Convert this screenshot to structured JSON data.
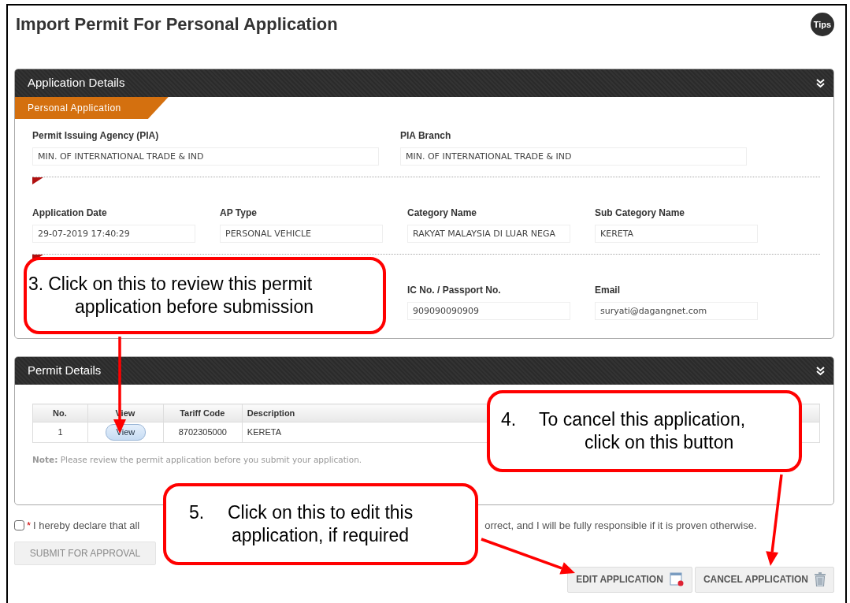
{
  "title": "Import Permit For Personal Application",
  "tips_button": "Tips",
  "application_panel": {
    "title": "Application Details",
    "section_tab": "Personal Application",
    "field_rows": [
      [
        {
          "label": "Permit Issuing Agency (PIA)",
          "value": "MIN. OF INTERNATIONAL TRADE & IND"
        },
        {
          "label": "PIA Branch",
          "value": "MIN. OF INTERNATIONAL TRADE & IND"
        }
      ],
      [
        {
          "label": "Application Date",
          "value": "29-07-2019 17:40:29"
        },
        {
          "label": "AP Type",
          "value": "PERSONAL VEHICLE"
        },
        {
          "label": "Category Name",
          "value": "RAKYAT MALAYSIA DI LUAR NEGA"
        },
        {
          "label": "Sub Category Name",
          "value": "KERETA"
        }
      ],
      [
        {
          "label": "IC No. / Passport No.",
          "value": "909090090909"
        },
        {
          "label": "Email",
          "value": "suryati@dagangnet.com"
        }
      ]
    ]
  },
  "permit_panel": {
    "title": "Permit Details",
    "table": {
      "columns": [
        "No.",
        "View",
        "Tariff Code",
        "Description"
      ],
      "rows": [
        {
          "no": "1",
          "view_button": "View",
          "tariff_code": "8702305000",
          "description": "KERETA"
        }
      ]
    },
    "note": "**Note:** Please review the permit application before you submit your application."
  },
  "declaration": {
    "checked": false,
    "required_mark": "*",
    "text_parts": [
      "I hereby declare that all",
      "orrect, and I will be fully responsible if it is proven otherwise."
    ]
  },
  "buttons": [
    {
      "kind": "submit",
      "label": "SUBMIT FOR APPROVAL",
      "disabled": true
    },
    {
      "kind": "edit",
      "label": "EDIT APPLICATION",
      "disabled": false
    },
    {
      "kind": "cancel",
      "label": "CANCEL APPLICATION",
      "disabled": false
    }
  ],
  "callouts": [
    {
      "number": "3.",
      "lines": [
        "Click on this to review this permit",
        "application before submission"
      ]
    },
    {
      "number": "4.",
      "lines": [
        "To cancel this application,",
        "click on this button"
      ]
    },
    {
      "number": "5.",
      "lines": [
        "Click on this to edit this",
        "application, if required"
      ]
    }
  ]
}
